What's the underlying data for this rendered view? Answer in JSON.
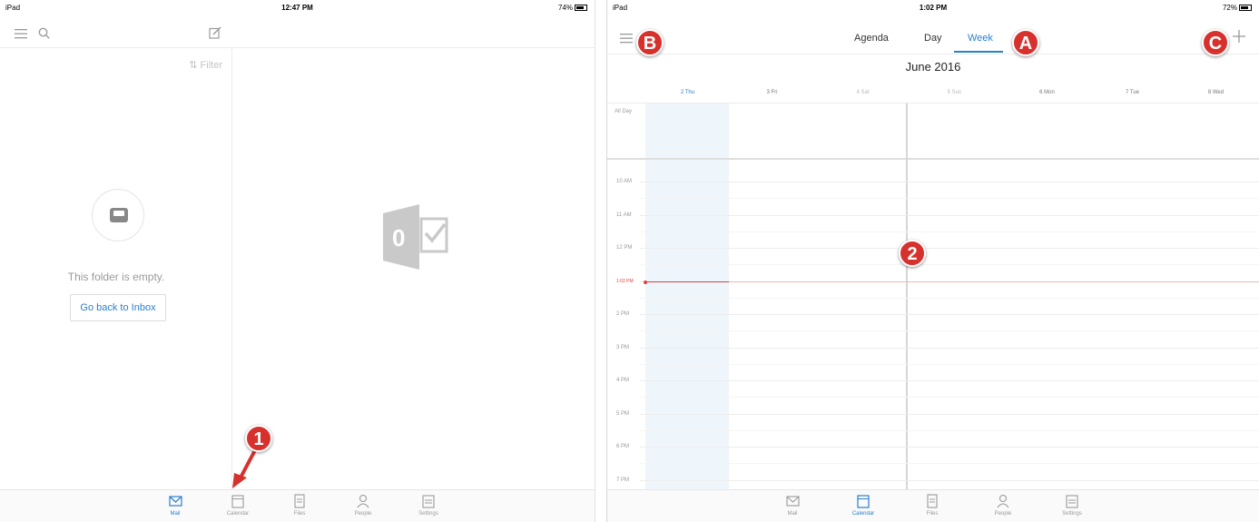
{
  "left": {
    "statusbar": {
      "device": "iPad",
      "time": "12:47 PM",
      "battery": "74%"
    },
    "toolbar": {
      "menu_icon": "hamburger-icon",
      "search_icon": "search-icon",
      "compose_icon": "compose-icon"
    },
    "mail_list": {
      "filter_label": "Filter",
      "empty_text": "This folder is empty.",
      "back_button": "Go back to Inbox"
    },
    "reader": {
      "logo_letter": "0"
    },
    "tabs": [
      {
        "label": "Mail",
        "icon": "mail-icon",
        "active": true
      },
      {
        "label": "Calendar",
        "icon": "calendar-icon",
        "active": false
      },
      {
        "label": "Files",
        "icon": "files-icon",
        "active": false
      },
      {
        "label": "People",
        "icon": "people-icon",
        "active": false
      },
      {
        "label": "Settings",
        "icon": "settings-icon",
        "active": false
      }
    ],
    "callout": "1"
  },
  "right": {
    "statusbar": {
      "device": "iPad",
      "time": "1:02 PM",
      "battery": "72%"
    },
    "toolbar": {
      "segments": [
        {
          "label": "Agenda",
          "active": false
        },
        {
          "label": "Day",
          "active": false
        },
        {
          "label": "Week",
          "active": true
        }
      ],
      "add_icon": "plus-icon",
      "menu_icon": "hamburger-icon"
    },
    "month": "June 2016",
    "days": [
      "2 Thu",
      "3 Fri",
      "4 Sat",
      "5 Sun",
      "6 Mon",
      "7 Tue",
      "8 Wed"
    ],
    "all_day_label": "All Day",
    "hours": [
      "10 AM",
      "11 AM",
      "12 PM",
      "2 PM",
      "3 PM",
      "4 PM",
      "5 PM",
      "6 PM",
      "7 PM"
    ],
    "now_label": "1:02 PM",
    "tabs": [
      {
        "label": "Mail",
        "icon": "mail-icon",
        "active": false
      },
      {
        "label": "Calendar",
        "icon": "calendar-icon",
        "active": true
      },
      {
        "label": "Files",
        "icon": "files-icon",
        "active": false
      },
      {
        "label": "People",
        "icon": "people-icon",
        "active": false
      },
      {
        "label": "Settings",
        "icon": "settings-icon",
        "active": false
      }
    ],
    "callouts": {
      "a": "A",
      "b": "B",
      "c": "C",
      "two": "2"
    }
  },
  "colors": {
    "accent": "#2a7fcf",
    "callout": "#d7312e",
    "now": "#e0403c",
    "today_col": "#eef5fb"
  }
}
